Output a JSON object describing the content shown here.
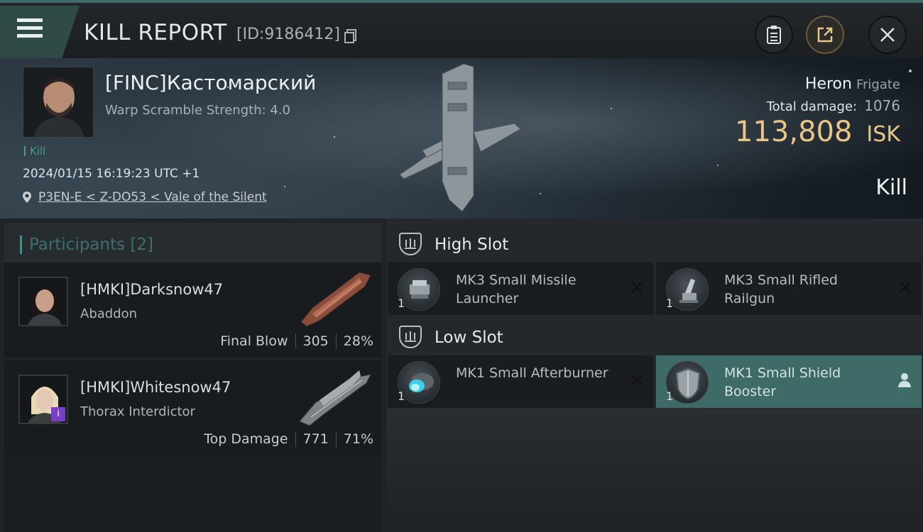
{
  "header": {
    "title": "KILL REPORT",
    "report_id": "[ID:9186412]",
    "menu_icon": "hamburger-menu-icon",
    "buttons": [
      "clipboard-icon",
      "share-icon",
      "close-icon"
    ]
  },
  "victim": {
    "name": "[FINC]Кастомарский",
    "warp_scramble": "Warp Scramble Strength: 4.0",
    "kill_tag": "Kill",
    "datetime": "2024/01/15 16:19:23 UTC +1",
    "location": "P3EN-E < Z-DO53 < Vale of the Silent",
    "ship_name": "Heron",
    "ship_class": "Frigate",
    "total_damage_label": "Total damage:",
    "total_damage": "1076",
    "isk_value": "113,808",
    "isk_unit": "ISK",
    "result": "Kill"
  },
  "participants": {
    "label": "Participants",
    "count": "[2]",
    "items": [
      {
        "name": "[HMKI]Darksnow47",
        "ship": "Abaddon",
        "role": "Final Blow",
        "damage": "305",
        "percent": "28%"
      },
      {
        "name": "[HMKI]Whitesnow47",
        "ship": "Thorax Interdictor",
        "role": "Top Damage",
        "damage": "771",
        "percent": "71%"
      }
    ]
  },
  "slots": {
    "high": {
      "title": "High Slot",
      "modules": [
        {
          "name": "MK3 Small Missile Launcher",
          "count": "1"
        },
        {
          "name": "MK3 Small Rifled Railgun",
          "count": "1"
        }
      ]
    },
    "low": {
      "title": "Low Slot",
      "modules": [
        {
          "name": "MK1 Small Afterburner",
          "count": "1"
        },
        {
          "name": "MK1 Small Shield Booster",
          "count": "1"
        }
      ]
    }
  },
  "colors": {
    "accent": "#4e9b8b",
    "isk": "#e9c687",
    "active_module": "#3e6b67"
  }
}
